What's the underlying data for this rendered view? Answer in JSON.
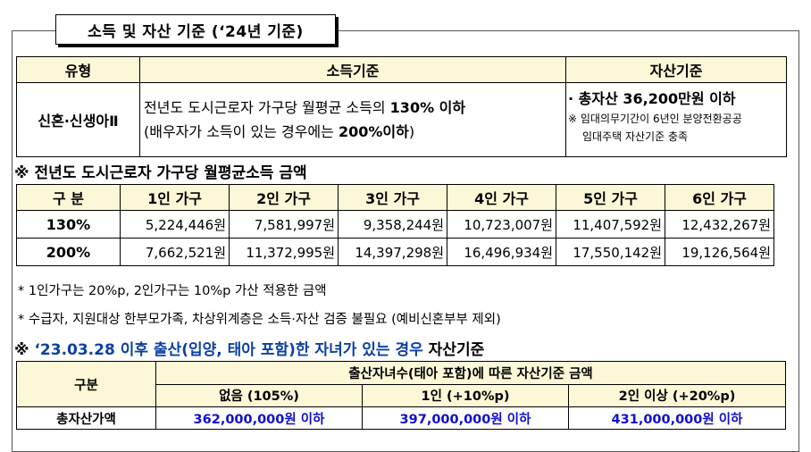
{
  "title": "소득 및 자산 기준 (‘24년 기준)",
  "criteria_table": {
    "headers": [
      "유형",
      "소득기준",
      "자산기준"
    ],
    "type": "신혼·신생아Ⅱ",
    "income_line1_pre": "전년도 도시근로자 가구당 월평균 소득의 ",
    "income_line1_bold": "130% 이하",
    "income_line2_pre": "(배우자가 소득이 있는 경우에는 ",
    "income_line2_bold": "200%이하",
    "income_line2_post": ")",
    "asset_main": "· 총자산 36,200만원 이하",
    "asset_note1": "※ 임대의무기간이 6년인 분양전환공공",
    "asset_note2": "임대주택 자산기준 충족"
  },
  "income_heading": "※ 전년도 도시근로자 가구당 월평균소득 금액",
  "income_table": {
    "headers": [
      "구 분",
      "1인 가구",
      "2인 가구",
      "3인 가구",
      "4인 가구",
      "5인 가구",
      "6인 가구"
    ],
    "rows": [
      {
        "label": "130%",
        "values": [
          "5,224,446원",
          "7,581,997원",
          "9,358,244원",
          "10,723,007원",
          "11,407,592원",
          "12,432,267원"
        ]
      },
      {
        "label": "200%",
        "values": [
          "7,662,521원",
          "11,372,995원",
          "14,397,298원",
          "16,496,934원",
          "17,550,142원",
          "19,126,564원"
        ]
      }
    ]
  },
  "note1": "* 1인가구는 20%p, 2인가구는 10%p 가산 적용한 금액",
  "note2": "* 수급자, 지원대상 한부모가족, 차상위계층은 소득·자산 검증 불필요 (예비신혼부부 제외)",
  "asset_heading": {
    "prefix": "※ ",
    "blue": "‘23.03.28 이후 출산(입양, 태아 포함)한 자녀가 있는 경우",
    "suffix": " 자산기준"
  },
  "asset_table": {
    "row_header": "구분",
    "group_header": "출산자녀수(태아 포함)에 따른 자산기준 금액",
    "columns": [
      "없음 (105%)",
      "1인 (+10%p)",
      "2인 이상 (+20%p)"
    ],
    "row_label": "총자산가액",
    "values": [
      "362,000,000원 이하",
      "397,000,000원 이하",
      "431,000,000원 이하"
    ]
  }
}
